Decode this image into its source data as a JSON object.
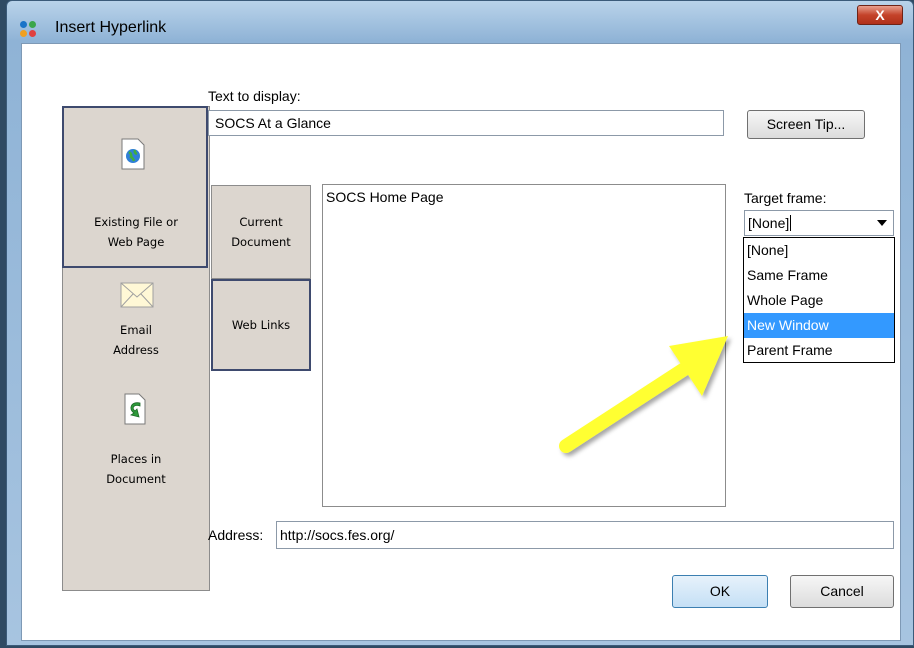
{
  "window": {
    "title": "Insert Hyperlink",
    "close_glyph": "X"
  },
  "left_nav": {
    "items": [
      {
        "label_line1": "Existing File or",
        "label_line2": "Web Page",
        "icon": "globe-document-icon"
      },
      {
        "label_line1": "Email",
        "label_line2": "Address",
        "icon": "envelope-icon"
      },
      {
        "label_line1": "Places in",
        "label_line2": "Document",
        "icon": "document-arrow-icon"
      }
    ]
  },
  "text_to_display": {
    "label": "Text to display:",
    "value": "SOCS At a Glance"
  },
  "screen_tip_button": "Screen Tip...",
  "tabs": [
    {
      "line1": "Current",
      "line2": "Document"
    },
    {
      "line1": "Web Links",
      "line2": ""
    }
  ],
  "links_list": {
    "items": [
      "SOCS Home Page"
    ]
  },
  "target_frame": {
    "label": "Target frame:",
    "value": "[None]",
    "options": [
      "[None]",
      "Same Frame",
      "Whole Page",
      "New Window",
      "Parent Frame"
    ],
    "highlighted": "New Window"
  },
  "address": {
    "label": "Address:",
    "value": "http://socs.fes.org/"
  },
  "buttons": {
    "ok": "OK",
    "cancel": "Cancel"
  },
  "colors": {
    "accent": "#3399ff",
    "annotation_arrow": "#ffff33",
    "close_button": "#c4432a"
  }
}
